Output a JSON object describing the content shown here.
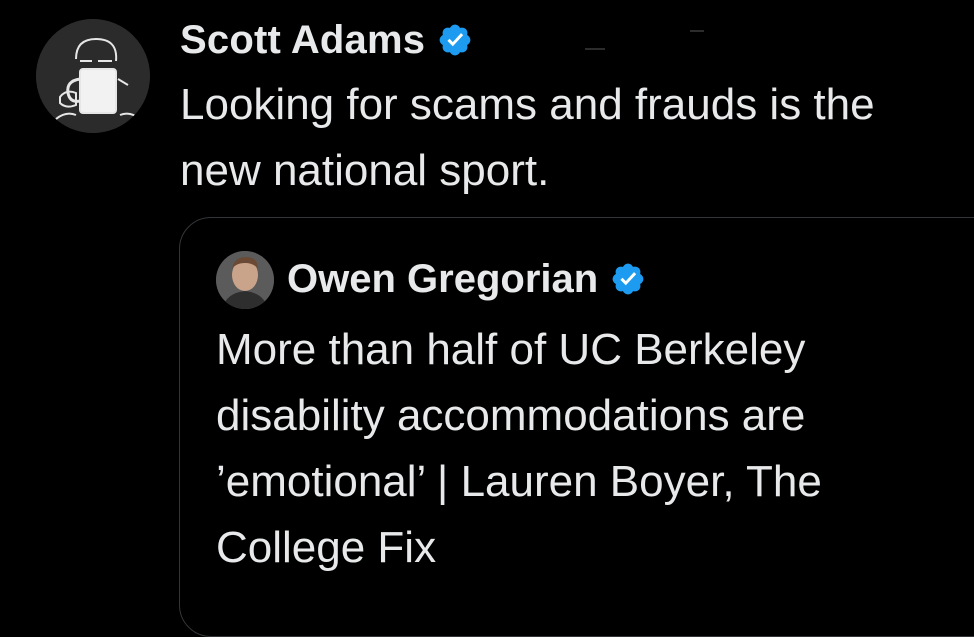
{
  "tweet": {
    "author": {
      "display_name": "Scott Adams",
      "verified": true,
      "avatar_icon": "coffee-mug-drinker-sketch-avatar"
    },
    "text": "Looking for scams and frauds is the\nnew national sport."
  },
  "quoted_tweet": {
    "author": {
      "display_name": "Owen Gregorian",
      "verified": true,
      "avatar_icon": "person-portrait-avatar"
    },
    "text": "More than half of UC Berkeley\ndisability accommodations are\n’emotional’ | Lauren Boyer, The\nCollege Fix"
  },
  "colors": {
    "background": "#000000",
    "text": "#e7e9ea",
    "verified_badge": "#1d9bf0",
    "card_border": "#333639"
  }
}
